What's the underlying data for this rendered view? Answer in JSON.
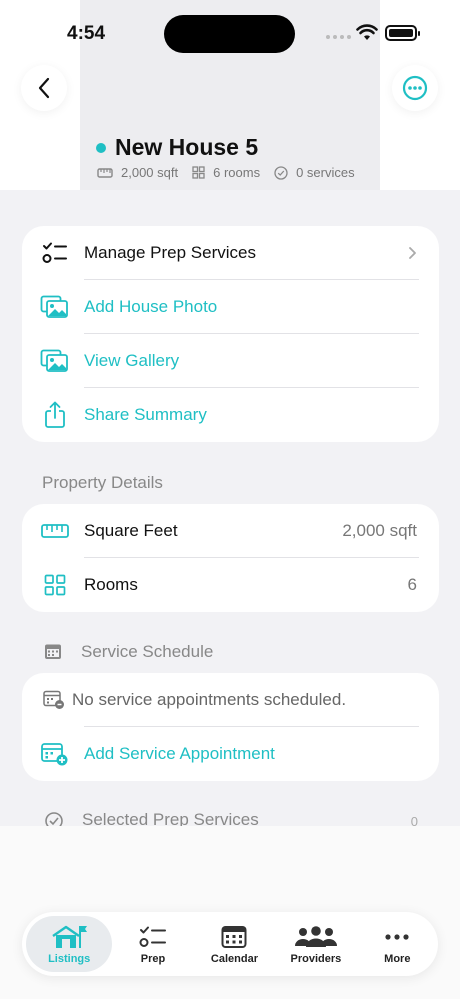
{
  "status_bar": {
    "time": "4:54"
  },
  "listing": {
    "title": "New House 5",
    "sqft": "2,000 sqft",
    "rooms": "6 rooms",
    "services": "0 services"
  },
  "actions": [
    {
      "label": "Manage Prep Services",
      "icon": "checklist-icon"
    },
    {
      "label": "Add House Photo",
      "icon": "photo-add-icon"
    },
    {
      "label": "View Gallery",
      "icon": "gallery-icon"
    },
    {
      "label": "Share Summary",
      "icon": "share-icon"
    }
  ],
  "property_details": {
    "heading": "Property Details",
    "square_feet_label": "Square Feet",
    "square_feet_value": "2,000 sqft",
    "rooms_label": "Rooms",
    "rooms_value": "6"
  },
  "service_schedule": {
    "heading": "Service Schedule",
    "empty_text": "No service appointments scheduled.",
    "add_label": "Add Service Appointment"
  },
  "selected_prep": {
    "heading": "Selected Prep Services",
    "count": "0"
  },
  "tabs": [
    {
      "label": "Listings",
      "icon": "house-flag-icon",
      "active": true
    },
    {
      "label": "Prep",
      "icon": "checklist-icon"
    },
    {
      "label": "Calendar",
      "icon": "calendar-icon"
    },
    {
      "label": "Providers",
      "icon": "people-icon"
    },
    {
      "label": "More",
      "icon": "ellipsis-icon"
    }
  ],
  "colors": {
    "accent": "#1fbfc4",
    "background": "#f2f2f5"
  }
}
